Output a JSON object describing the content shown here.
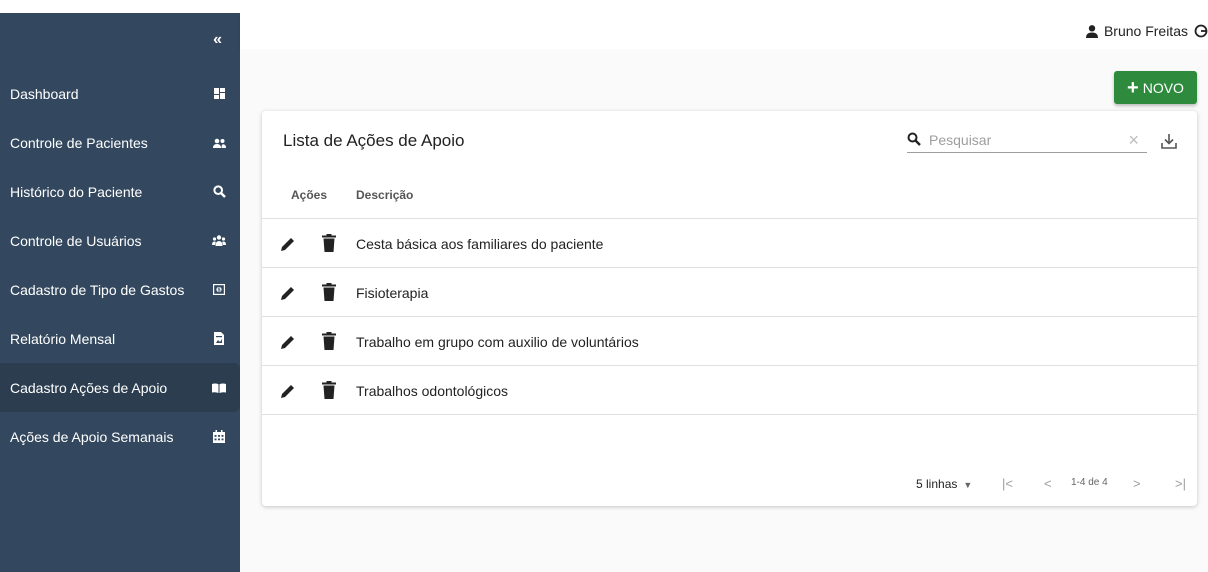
{
  "sidebar": {
    "collapse_label": "«",
    "items": [
      {
        "label": "Dashboard",
        "icon": "dashboard-icon"
      },
      {
        "label": "Controle de Pacientes",
        "icon": "users-icon"
      },
      {
        "label": "Histórico do Paciente",
        "icon": "search-icon"
      },
      {
        "label": "Controle de Usuários",
        "icon": "users-cog-icon"
      },
      {
        "label": "Cadastro de Tipo de Gastos",
        "icon": "money-icon"
      },
      {
        "label": "Relatório Mensal",
        "icon": "report-icon"
      },
      {
        "label": "Cadastro Ações de Apoio",
        "icon": "book-icon",
        "active": true
      },
      {
        "label": "Ações de Apoio Semanais",
        "icon": "calendar-icon"
      }
    ]
  },
  "header": {
    "user_name": "Bruno Freitas"
  },
  "toolbar": {
    "new_label": "NOVO",
    "new_plus": "+"
  },
  "card": {
    "title": "Lista de Ações de Apoio",
    "search_placeholder": "Pesquisar",
    "clear_symbol": "×"
  },
  "table": {
    "columns": [
      "Ações",
      "Descrição"
    ],
    "rows": [
      {
        "descricao": "Cesta básica aos familiares do paciente"
      },
      {
        "descricao": "Fisioterapia"
      },
      {
        "descricao": "Trabalho em grupo com auxilio de voluntários"
      },
      {
        "descricao": "Trabalhos odontológicos"
      }
    ]
  },
  "pagination": {
    "rows_label": "5 linhas",
    "caret": "▼",
    "first": "|<",
    "prev": "<",
    "info": "1-4 de 4",
    "next": ">",
    "last": ">|"
  },
  "colors": {
    "sidebar_bg": "#33485e",
    "sidebar_active": "#2b3d4f",
    "accent_green": "#2e8b3d"
  }
}
